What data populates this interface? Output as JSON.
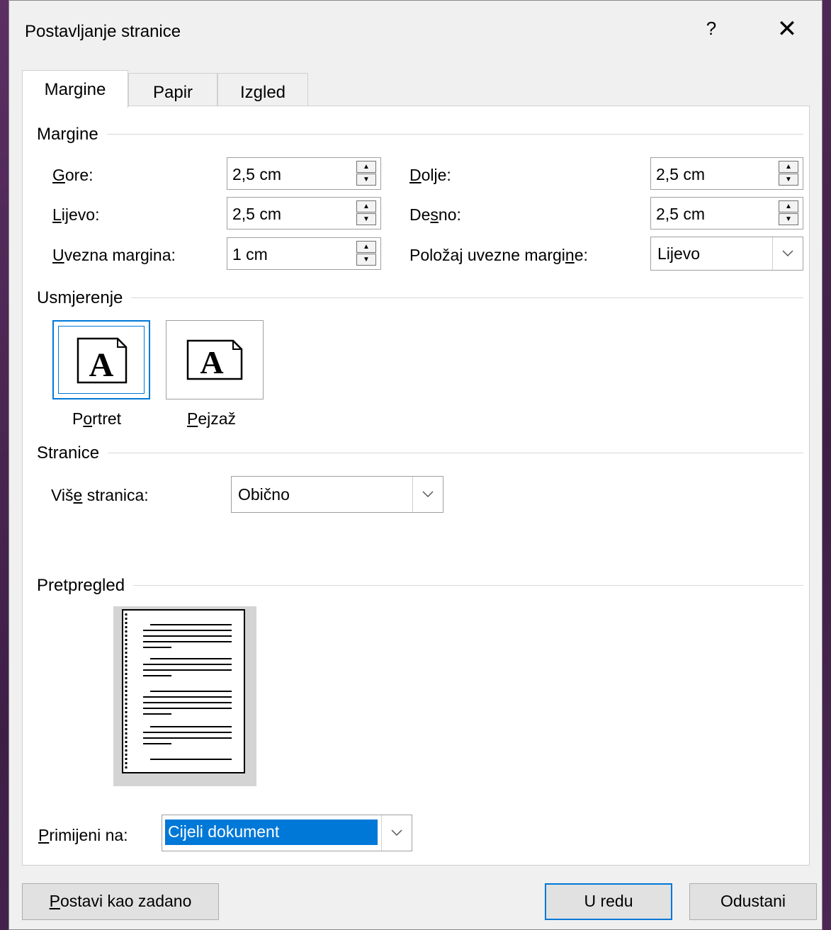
{
  "dialog": {
    "title": "Postavljanje stranice",
    "help_symbol": "?",
    "close_symbol": "✕"
  },
  "tabs": [
    {
      "label": "Margine"
    },
    {
      "label": "Papir"
    },
    {
      "label": "Izgled"
    }
  ],
  "margins_group": {
    "label": "Margine",
    "top": {
      "label": "Gore:",
      "accel": "G",
      "rest": "ore:",
      "value": "2,5 cm"
    },
    "bottom": {
      "label": "Dolje:",
      "accel": "D",
      "rest": "olje:",
      "value": "2,5 cm"
    },
    "left": {
      "label": "Lijevo:",
      "accel": "L",
      "rest": "ijevo:",
      "value": "2,5 cm"
    },
    "right": {
      "label": "Desno:",
      "pre": "De",
      "accel": "s",
      "rest": "no:",
      "value": "2,5 cm"
    },
    "gutter": {
      "label": "Uvezna margina:",
      "accel": "U",
      "rest": "vezna margina:",
      "value": "1 cm"
    },
    "gutter_position": {
      "label": "Položaj uvezne margine:",
      "pre": "Položaj uvezne margi",
      "accel": "n",
      "rest": "e:",
      "value": "Lijevo"
    }
  },
  "orientation_group": {
    "label": "Usmjerenje",
    "portrait": {
      "label": "Portret",
      "pre": "P",
      "accel": "o",
      "rest": "rtret",
      "glyph": "A"
    },
    "landscape": {
      "label": "Pejzaž",
      "pre": "",
      "accel": "P",
      "rest": "ejzaž",
      "glyph": "A"
    },
    "selected": "portrait"
  },
  "pages_group": {
    "label": "Stranice",
    "multiple_pages": {
      "label": "Više stranica:",
      "pre": "Viš",
      "accel": "e",
      "rest": " stranica:",
      "value": "Obično"
    }
  },
  "preview_group": {
    "label": "Pretpregled"
  },
  "apply_to": {
    "label": "Primijeni na:",
    "accel": "P",
    "rest": "rimijeni na:",
    "value": "Cijeli dokument"
  },
  "buttons": {
    "set_default": {
      "label": "Postavi kao zadano",
      "accel": "P",
      "rest": "ostavi kao zadano"
    },
    "ok": "U redu",
    "cancel": "Odustani"
  },
  "colors": {
    "accent": "#0078d7",
    "selection": "#0078d7",
    "background": "#f0f0f0",
    "panel": "#ffffff"
  },
  "icons": {
    "spin_up": "spin-up-icon",
    "spin_down": "spin-down-icon",
    "dropdown": "chevron-down-icon",
    "close": "close-icon",
    "help": "help-icon"
  }
}
